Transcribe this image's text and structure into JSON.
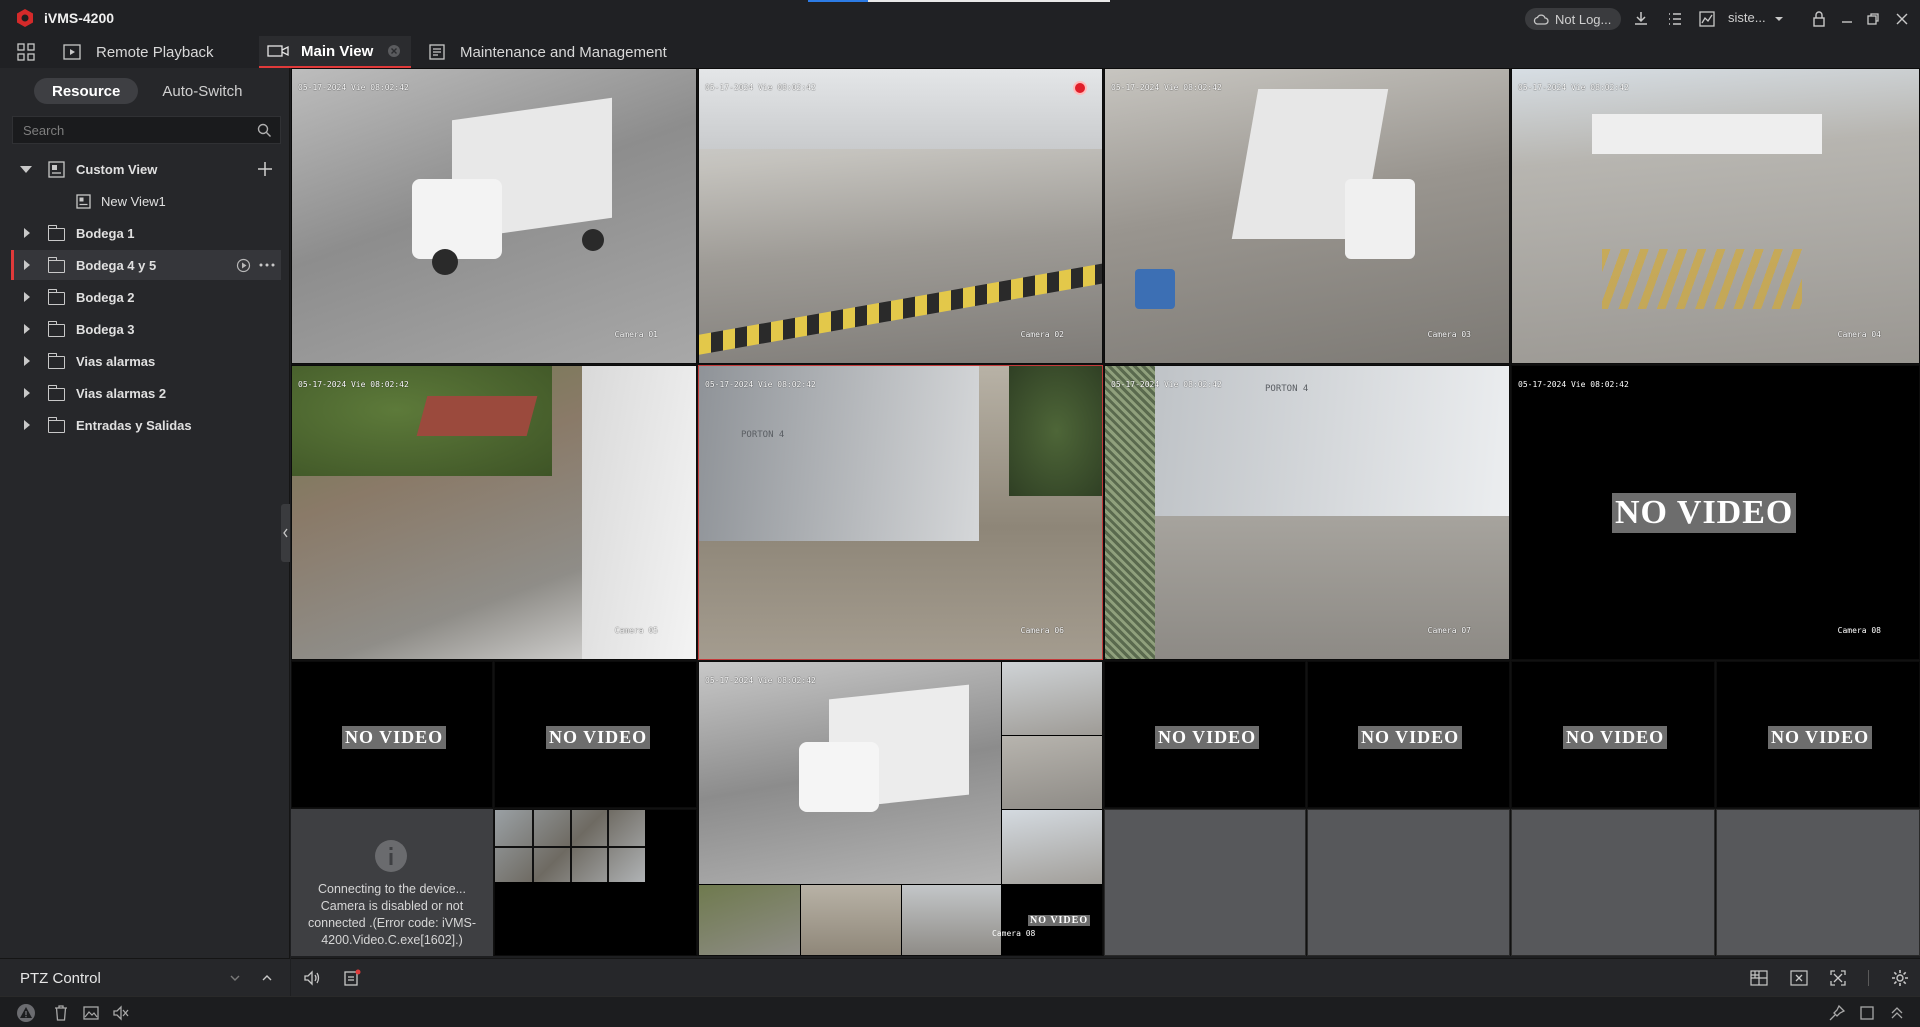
{
  "app": {
    "title": "iVMS-4200",
    "login_status": "Not Log...",
    "user_label": "siste..."
  },
  "tabs": [
    {
      "label": "Remote Playback"
    },
    {
      "label": "Main View"
    },
    {
      "label": "Maintenance and Management"
    }
  ],
  "left_panel": {
    "segment_tabs": [
      "Resource",
      "Auto-Switch"
    ],
    "search_placeholder": "Search",
    "tree": [
      {
        "label": "Custom View",
        "expanded": true
      },
      {
        "label": "New View1"
      },
      {
        "label": "Bodega 1"
      },
      {
        "label": "Bodega 4 y 5",
        "selected": true
      },
      {
        "label": "Bodega 2"
      },
      {
        "label": "Bodega 3"
      },
      {
        "label": "Vias alarmas"
      },
      {
        "label": "Vias alarmas 2"
      },
      {
        "label": "Entradas y Salidas"
      }
    ],
    "ptz_label": "PTZ Control"
  },
  "video": {
    "timestamp": "05-17-2024 Vie 08:02:42",
    "no_video": "NO VIDEO",
    "cameras": [
      "Camera 01",
      "Camera 02",
      "Camera 03",
      "Camera 04",
      "Camera 05",
      "Camera 06",
      "Camera 07",
      "Camera 08"
    ],
    "error_message": "Connecting to the device... Camera is disabled or not connected .(Error code: iVMS-4200.Video.C.exe[1602].)",
    "mini_cam_label": "Camera 08",
    "scene_labels": [
      "PORTON 4",
      "PORTON 4"
    ]
  },
  "colors": {
    "accent_red": "#e03a3a",
    "background": "#1e1f21",
    "panel": "#26272a"
  }
}
